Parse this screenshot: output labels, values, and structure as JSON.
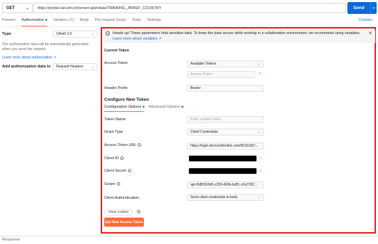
{
  "request": {
    "method": "GET",
    "url": "https://portal-uat.who.int/smart-api/odata/TRAINING_JB/REF_COUNTRY",
    "send_label": "Send"
  },
  "tabs": [
    {
      "label": "Params"
    },
    {
      "label": "Authorization"
    },
    {
      "label": "Headers (7)"
    },
    {
      "label": "Body"
    },
    {
      "label": "Pre-request Script"
    },
    {
      "label": "Tests"
    },
    {
      "label": "Settings"
    }
  ],
  "cookies_label": "Cookies",
  "left": {
    "type_label": "Type",
    "type_value": "OAuth 2.0",
    "description": "The authorization data will be automatically generated when you send the request.",
    "learn_more": "Learn more about authorization ↗",
    "add_label": "Add authorization data to",
    "add_value": "Request Headers"
  },
  "banner": {
    "text": "Heads up! These parameters hold sensitive data. To keep this data secure while working in a collaborative environment, we recommend using variables.",
    "link": "Learn more about variables ↗"
  },
  "current_token": {
    "title": "Current Token",
    "access_token_label": "Access Token",
    "available_tokens": "Available Tokens",
    "access_token_placeholder": "Access Token",
    "header_prefix_label": "Header Prefix",
    "header_prefix_value": "Bearer"
  },
  "configure": {
    "title": "Configure New Token",
    "tab_active": "Configuration Options",
    "tab_inactive": "Advanced Options",
    "token_name_label": "Token Name",
    "token_name_placeholder": "Enter a token name...",
    "grant_type_label": "Grant Type",
    "grant_type_value": "Client Credentials",
    "access_token_url_label": "Access Token URL",
    "access_token_url_value": "https://login.microsoftonline.com/f610c0b7...",
    "client_id_label": "Client ID",
    "client_secret_label": "Client Secret",
    "scope_label": "Scope",
    "scope_value": "api://b85362d6-c259-490b-bd51-c0a730C...",
    "client_auth_label": "Client Authentication",
    "client_auth_value": "Send client credentials in body",
    "clear_cookies": "Clear cookies",
    "get_token": "Get New Access Token"
  },
  "response_label": "Response",
  "colors": {
    "accent": "#ff6c37",
    "send": "#0b69d8",
    "highlight": "#e51a1a",
    "status_dot": "#0cbb52"
  }
}
